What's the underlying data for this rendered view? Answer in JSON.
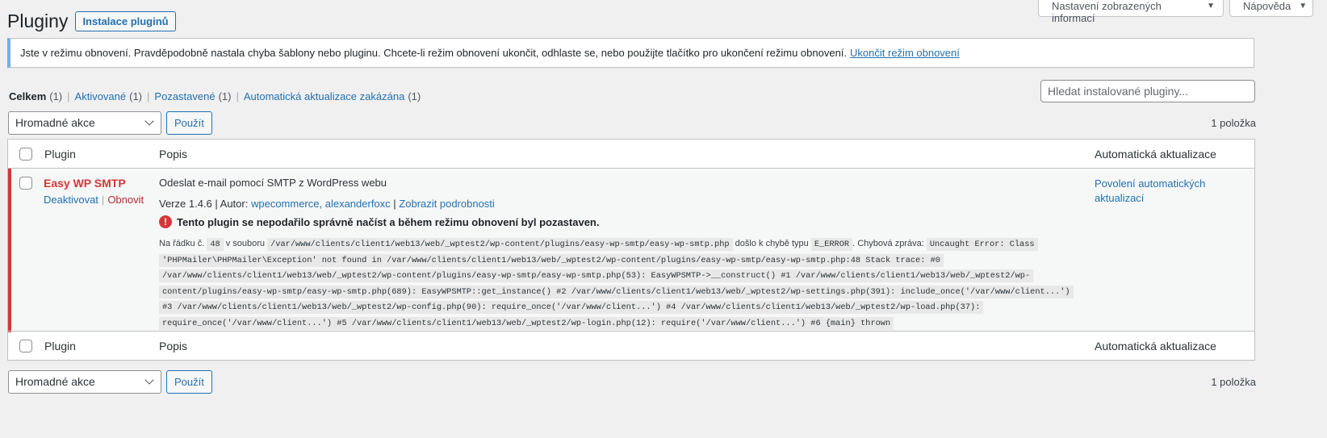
{
  "screen_meta": {
    "screen_options": "Nastavení zobrazených informací",
    "help": "Nápověda"
  },
  "header": {
    "title": "Pluginy",
    "add_new": "Instalace pluginů"
  },
  "notice": {
    "text": "Jste v režimu obnovení. Pravděpodobně nastala chyba šablony nebo pluginu. Chcete-li režim obnovení ukončit, odhlaste se, nebo použijte tlačítko pro ukončení režimu obnovení.",
    "link": "Ukončit režim obnovení",
    "accent_color": "#72aee6"
  },
  "views": [
    {
      "label": "Celkem",
      "count": "(1)",
      "current": true
    },
    {
      "label": "Aktivované",
      "count": "(1)",
      "current": false
    },
    {
      "label": "Pozastavené",
      "count": "(1)",
      "current": false
    },
    {
      "label": "Automatická aktualizace zakázána",
      "count": "(1)",
      "current": false
    }
  ],
  "search": {
    "placeholder": "Hledat instalované pluginy..."
  },
  "tablenav": {
    "bulk_action": "Hromadné akce",
    "apply": "Použít",
    "count": "1 položka"
  },
  "table": {
    "col_plugin": "Plugin",
    "col_description": "Popis",
    "col_auto_update": "Automatická aktualizace"
  },
  "plugin": {
    "name": "Easy WP SMTP",
    "deactivate": "Deaktivovat",
    "resume": "Obnovit",
    "description": "Odeslat e-mail pomocí SMTP z WordPress webu",
    "version_prefix": "Verze 1.4.6 | Autor:",
    "author": "wpecommerce, alexanderfoxc",
    "details": "Zobrazit podrobnosti",
    "error_title": "Tento plugin se nepodařilo správně načíst a během režimu obnovení byl pozastaven.",
    "error_line_label": "Na řádku č.",
    "error_line": "48",
    "error_file_label": "v souboru",
    "error_file": "/var/www/clients/client1/web13/web/_wptest2/wp-content/plugins/easy-wp-smtp/easy-wp-smtp.php",
    "error_type_label": "došlo k chybě typu",
    "error_type": "E_ERROR",
    "error_msg_label": ". Chybová zpráva:",
    "error_message": "Uncaught Error: Class 'PHPMailer\\PHPMailer\\Exception' not found in /var/www/clients/client1/web13/web/_wptest2/wp-content/plugins/easy-wp-smtp/easy-wp-smtp.php:48 Stack trace: #0 /var/www/clients/client1/web13/web/_wptest2/wp-content/plugins/easy-wp-smtp/easy-wp-smtp.php(53): EasyWPSMTP->__construct() #1 /var/www/clients/client1/web13/web/_wptest2/wp-content/plugins/easy-wp-smtp/easy-wp-smtp.php(689): EasyWPSMTP::get_instance() #2 /var/www/clients/client1/web13/web/_wptest2/wp-settings.php(391): include_once('/var/www/client...') #3 /var/www/clients/client1/web13/web/_wptest2/wp-config.php(90): require_once('/var/www/client...') #4 /var/www/clients/client1/web13/web/_wptest2/wp-load.php(37): require_once('/var/www/client...') #5 /var/www/clients/client1/web13/web/_wptest2/wp-login.php(12): require('/var/www/client...') #6 {main} thrown",
    "auto_update_link": "Povolení automatických aktualizací",
    "error_color": "#d63638"
  }
}
